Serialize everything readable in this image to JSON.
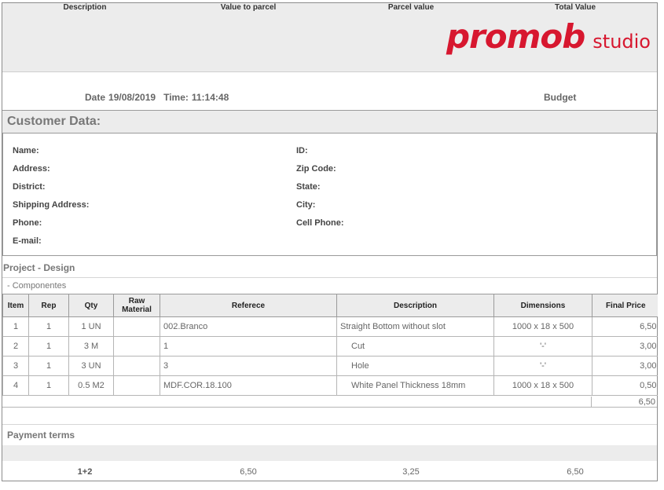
{
  "logo": {
    "brand": "promob",
    "sub": "studio"
  },
  "meta": {
    "date_label": "Date",
    "date": "19/08/2019",
    "time_label": "Time:",
    "time": "11:14:48",
    "doc_type": "Budget"
  },
  "customer": {
    "title": "Customer Data:",
    "fields_left": [
      "Name:",
      "Address:",
      "District:",
      "Shipping Address:",
      "Phone:",
      "E-mail:"
    ],
    "fields_right": [
      "ID:",
      "Zip Code:",
      "State:",
      "City:",
      "Cell Phone:"
    ]
  },
  "project": {
    "title": "Project - Design",
    "section": "- Componentes"
  },
  "items_table": {
    "columns": [
      "Item",
      "Rep",
      "Qty",
      "Raw Material",
      "Referece",
      "Description",
      "Dimensions",
      "Final Price"
    ],
    "rows": [
      {
        "item": "1",
        "rep": "1",
        "qty": "1 UN",
        "raw": "",
        "ref": "002.Branco",
        "desc": "Straight Bottom without slot",
        "dims": "1000 x 18 x 500",
        "price": "6,50"
      },
      {
        "item": "2",
        "rep": "1",
        "qty": "3 M",
        "raw": "",
        "ref": "1",
        "desc": "Cut",
        "dims": "'-'",
        "price": "3,00"
      },
      {
        "item": "3",
        "rep": "1",
        "qty": "3 UN",
        "raw": "",
        "ref": "3",
        "desc": "Hole",
        "dims": "'-'",
        "price": "3,00"
      },
      {
        "item": "4",
        "rep": "1",
        "qty": "0.5 M2",
        "raw": "",
        "ref": "MDF.COR.18.100",
        "desc": "White Panel Thickness 18mm",
        "dims": "1000 x 18 x 500",
        "price": "0,50"
      }
    ],
    "subtotal": "6,50"
  },
  "payment": {
    "title": "Payment terms",
    "columns": [
      "Description",
      "Value to parcel",
      "Parcel value",
      "Total Value"
    ],
    "row": {
      "description": "1+2",
      "value_to_parcel": "6,50",
      "parcel_value": "3,25",
      "total_value": "6,50"
    }
  }
}
